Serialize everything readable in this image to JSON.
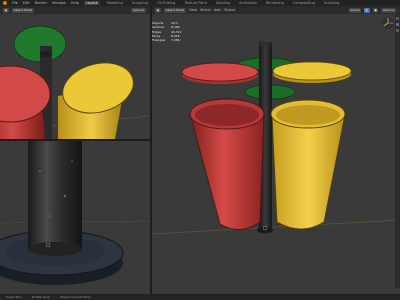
{
  "app": {
    "logo": "blender-logo-icon",
    "menus": [
      "File",
      "Edit",
      "Render",
      "Window",
      "Help"
    ],
    "workspaces": [
      "Layout",
      "Modeling",
      "Sculpting",
      "UV Editing",
      "Texture Paint",
      "Shading",
      "Animation",
      "Rendering",
      "Compositing",
      "Scripting"
    ],
    "active_workspace": "Layout"
  },
  "viewport_main": {
    "mode": "Object Mode",
    "menus": [
      "View",
      "Select",
      "Add",
      "Object"
    ],
    "shading_options": "Options",
    "global_label": "Global"
  },
  "viewport_top_left": {
    "mode": "Object Mode",
    "options": "Options"
  },
  "statistics": {
    "rows": [
      {
        "label": "Objects",
        "value": "0/13"
      },
      {
        "label": "Vertices",
        "value": "8,296"
      },
      {
        "label": "Edges",
        "value": "16,312"
      },
      {
        "label": "Faces",
        "value": "8,018"
      },
      {
        "label": "Triangles",
        "value": "7,986"
      }
    ]
  },
  "status": {
    "left": "Select Box",
    "middle": "Rotate View",
    "right": "Object Context Menu"
  },
  "colors": {
    "red": "#c43b3a",
    "yellow": "#e4b92a",
    "green": "#1f7a2b",
    "pole": "#2a2a2a",
    "accent": "#4772b3"
  }
}
